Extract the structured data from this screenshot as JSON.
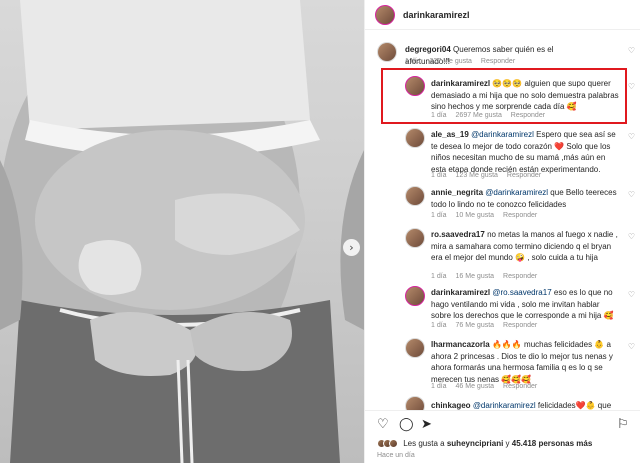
{
  "post": {
    "username": "darinkaramirezl",
    "next_icon": "chevron-right-icon"
  },
  "comments": [
    {
      "user": "degregori04",
      "text": "Queremos saber quién es el afortunado!!!",
      "time": "1 día",
      "likes": "327 Me gusta",
      "reply": "Responder"
    },
    {
      "user": "darinkaramirezl",
      "text": "🥺🥺🥺 alguien que supo querer demasiado a mi hija que no solo demuestra palabras sino hechos y me sorprende cada día 🥰",
      "time": "1 día",
      "likes": "2697 Me gusta",
      "reply": "Responder"
    },
    {
      "user": "ale_as_19",
      "mention": "@darinkaramirezl",
      "text": "Espero que sea así se te desea lo mejor de todo corazón ❤️ Solo que los niños necesitan mucho de su mamá ,más aún en esta etapa donde recién están experimentando.",
      "time": "1 día",
      "likes": "123 Me gusta",
      "reply": "Responder"
    },
    {
      "user": "annie_negrita",
      "mention": "@darinkaramirezl",
      "text": "que Bello teereces todo lo lindo no te conozco felicidades",
      "time": "1 día",
      "likes": "10 Me gusta",
      "reply": "Responder"
    },
    {
      "user": "ro.saavedra17",
      "text": "no metas la manos al fuego x nadie , mira a samahara como termino diciendo q el bryan era el mejor del mundo 🤪 , solo cuida a tu hija",
      "time": "1 día",
      "likes": "16 Me gusta",
      "reply": "Responder"
    },
    {
      "user": "darinkaramirezl",
      "mention": "@ro.saavedra17",
      "text": "eso es lo que no hago ventilando mi vida , solo me invitan hablar sobre los derechos que le corresponde a mi hija 🥰",
      "time": "1 día",
      "likes": "76 Me gusta",
      "reply": "Responder"
    },
    {
      "user": "lharmancazorla",
      "text": "🔥🔥🔥 muchas felicidades 👶 a ahora 2 princesas . Dios te dio lo mejor tus nenas y ahora formarás una hermosa familia q es lo q se merecen tus nenas 🥰🥰🥰",
      "time": "1 día",
      "likes": "46 Me gusta",
      "reply": "Responder"
    },
    {
      "user": "chinkageo",
      "mention": "@darinkaramirezl",
      "text": "felicidades❤️👶 que",
      "time": "",
      "likes": "",
      "reply": ""
    }
  ],
  "actions": {
    "like_icon": "heart-icon",
    "comment_icon": "comment-icon",
    "share_icon": "share-icon",
    "save_icon": "bookmark-icon"
  },
  "likes_summary": {
    "prefix": "Les gusta a",
    "user": "suheyncipriani",
    "connector": "y",
    "count": "45.418 personas más"
  },
  "posted_ago": "Hace un día",
  "highlight_color": "#e0191f"
}
